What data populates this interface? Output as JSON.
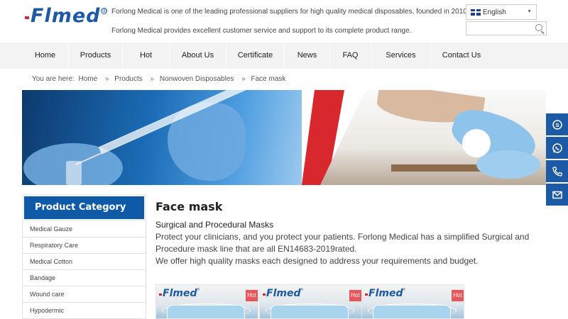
{
  "header": {
    "logo_text": "Flmed",
    "logo_reg": "®",
    "tagline_1": "Forlong Medical is one of the leading professional suppliers for high quality medical disposables, founded in 2010.",
    "tagline_2": "Forlong Medical provides excellent customer service and support to its complete product range.",
    "language": "English",
    "search_placeholder": ""
  },
  "nav": {
    "items": [
      "Home",
      "Products",
      "Hot",
      "About Us",
      "Certificate",
      "News",
      "FAQ",
      "Services",
      "Contact Us"
    ]
  },
  "breadcrumb": {
    "prefix": "You are here:",
    "items": [
      "Home",
      "Products",
      "Nonwoven Disposables",
      "Face mask"
    ],
    "separator": "»"
  },
  "sidebar": {
    "title": "Product Category",
    "items": [
      "Medical Gauze",
      "Respiratory Care",
      "Medical Cotton",
      "Bandage",
      "Wound care",
      "Hypodermic"
    ]
  },
  "main": {
    "title": "Face mask",
    "subtitle": "Surgical and Procedural Masks",
    "description_1": "Protect your clinicians, and you protect your patients. Forlong Medical has a simplified Surgical and Procedure mask line that are all EN14683-2019rated.",
    "description_2": "We offer high quality masks each designed to address your requirements and budget."
  },
  "products": [
    {
      "logo": "Flmed",
      "badge": "Hot"
    },
    {
      "logo": "Flmed",
      "badge": "Hot"
    },
    {
      "logo": "Flmed",
      "badge": "Hot"
    }
  ],
  "contact_buttons": [
    "skype-icon",
    "whatsapp-icon",
    "phone-icon",
    "email-icon"
  ],
  "colors": {
    "brand_blue": "#1d5aa5",
    "brand_red": "#d9272e",
    "category_header": "#0e5aa7",
    "hot_badge": "#e8555a",
    "nav_bg": "#f3f3f3"
  }
}
